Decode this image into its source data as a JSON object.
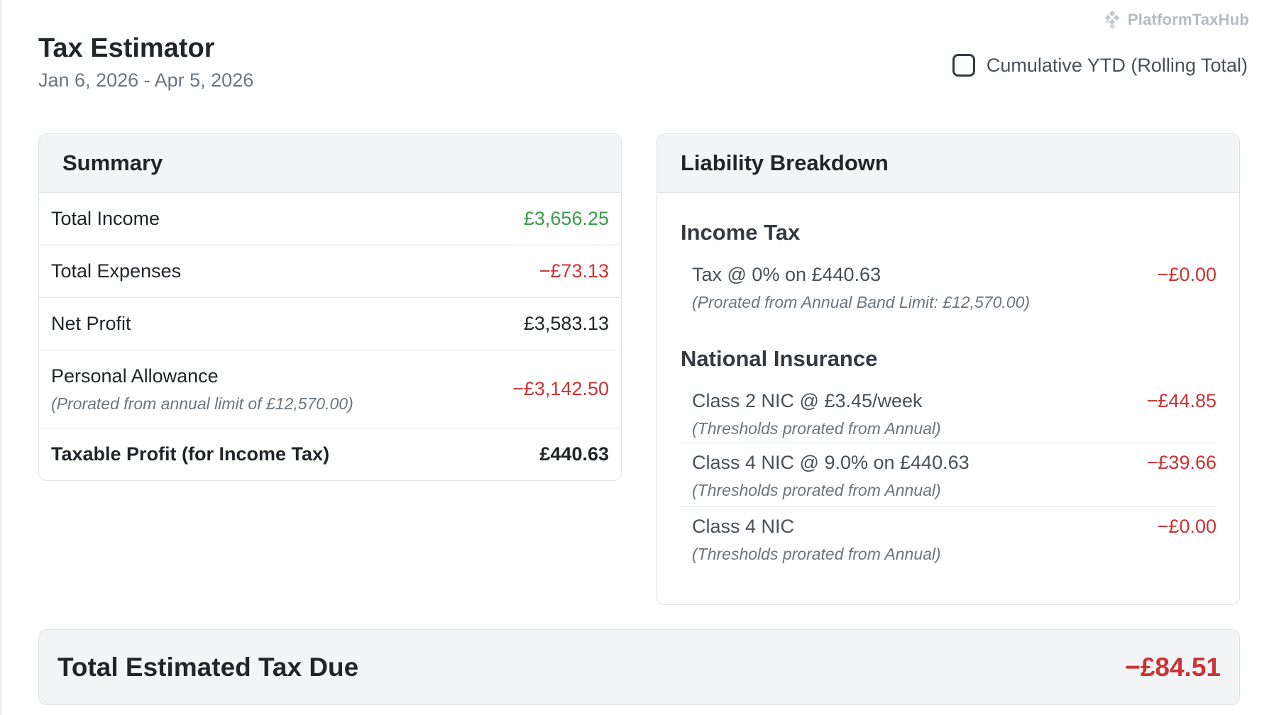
{
  "brand": {
    "name": "PlatformTaxHub",
    "icon": "diamond-grid-logo"
  },
  "header": {
    "title": "Tax Estimator",
    "date_range": "Jan 6, 2026 - Apr 5, 2026"
  },
  "toggle": {
    "label": "Cumulative YTD (Rolling Total)",
    "checked": false
  },
  "summary": {
    "title": "Summary",
    "rows": [
      {
        "label": "Total Income",
        "value": "£3,656.25",
        "color": "#3a9a4e"
      },
      {
        "label": "Total Expenses",
        "value": "−£73.13",
        "color": "#cc3333"
      },
      {
        "label": "Net Profit",
        "value": "£3,583.13",
        "color": "#212529"
      },
      {
        "label": "Personal Allowance",
        "note": "(Prorated from annual limit of £12,570.00)",
        "value": "−£3,142.50",
        "color": "#cc3333"
      },
      {
        "label": "Taxable Profit (for Income Tax)",
        "value": "£440.63",
        "color": "#212529"
      }
    ]
  },
  "liability": {
    "title": "Liability Breakdown",
    "income_tax": {
      "title": "Income Tax",
      "items": [
        {
          "label": "Tax @ 0% on £440.63",
          "note": "(Prorated from Annual Band Limit: £12,570.00)",
          "value": "−£0.00"
        }
      ]
    },
    "national_insurance": {
      "title": "National Insurance",
      "items": [
        {
          "label": "Class 2 NIC @ £3.45/week",
          "note": "(Thresholds prorated from Annual)",
          "value": "−£44.85"
        },
        {
          "label": "Class 4 NIC @ 9.0% on £440.63",
          "note": "(Thresholds prorated from Annual)",
          "value": "−£39.66"
        },
        {
          "label": "Class 4 NIC",
          "note": "(Thresholds prorated from Annual)",
          "value": "−£0.00"
        }
      ]
    }
  },
  "total": {
    "label": "Total Estimated Tax Due",
    "value": "−£84.51",
    "color": "#cc3333"
  }
}
